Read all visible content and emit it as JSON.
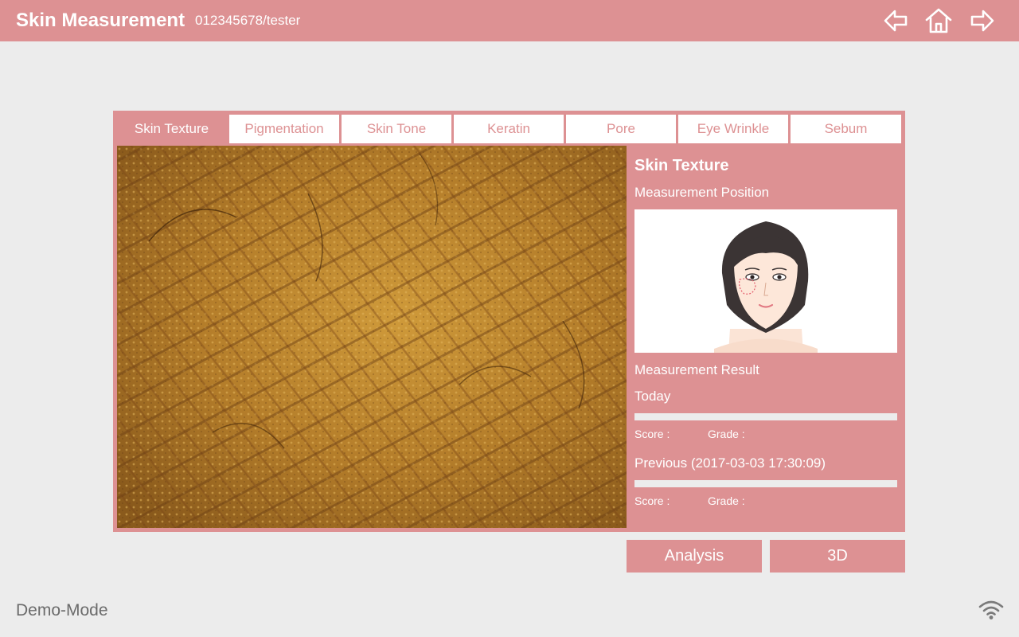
{
  "header": {
    "title": "Skin Measurement",
    "user": "012345678/tester",
    "icons": [
      "back-arrow-icon",
      "home-icon",
      "forward-arrow-icon"
    ]
  },
  "tabs": [
    {
      "label": "Skin Texture",
      "active": true
    },
    {
      "label": "Pigmentation",
      "active": false
    },
    {
      "label": "Skin Tone",
      "active": false
    },
    {
      "label": "Keratin",
      "active": false
    },
    {
      "label": "Pore",
      "active": false
    },
    {
      "label": "Eye Wrinkle",
      "active": false
    },
    {
      "label": "Sebum",
      "active": false
    }
  ],
  "info": {
    "title": "Skin Texture",
    "position_label": "Measurement Position",
    "result_label": "Measurement Result",
    "today": {
      "label": "Today",
      "score_label": "Score :",
      "grade_label": "Grade :",
      "progress": 0
    },
    "previous": {
      "label": "Previous (2017-03-03 17:30:09)",
      "score_label": "Score :",
      "grade_label": "Grade :",
      "progress": 0
    }
  },
  "buttons": {
    "analysis": "Analysis",
    "three_d": "3D"
  },
  "footer": {
    "mode": "Demo-Mode",
    "icon": "wifi-icon"
  },
  "colors": {
    "accent": "#dd9193",
    "background": "#ececec",
    "skin": "#b07a28"
  }
}
